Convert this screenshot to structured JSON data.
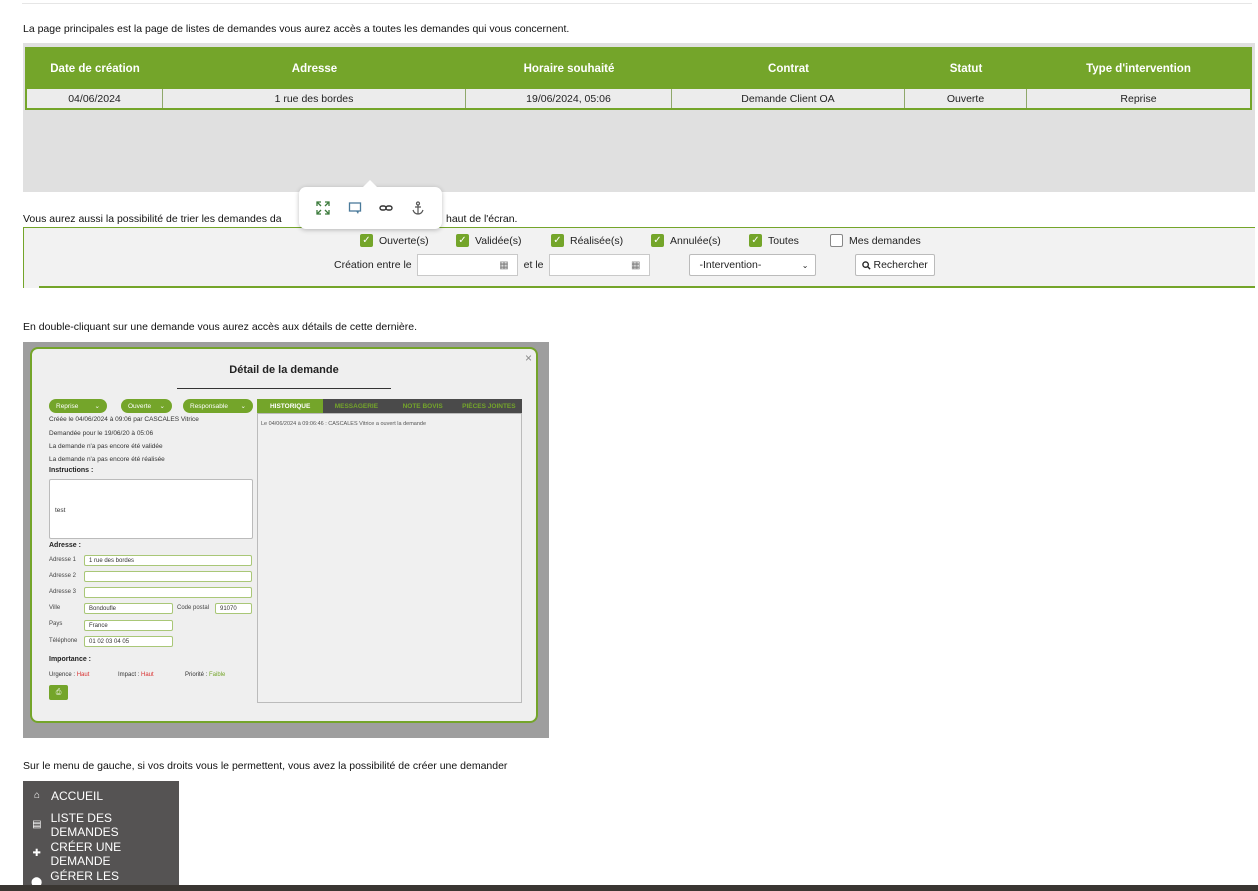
{
  "intro_text": "La page principales est la page de listes de demandes vous aurez accès a toutes les demandes qui vous concernent.",
  "table": {
    "headers": [
      "Date de création",
      "Adresse",
      "Horaire souhaité",
      "Contrat",
      "Statut",
      "Type d'intervention"
    ],
    "rows": [
      [
        "04/06/2024",
        "1 rue des bordes",
        "19/06/2024, 05:06",
        "Demande Client OA",
        "Ouverte",
        "Reprise"
      ]
    ]
  },
  "popover_icons": [
    "expand-icon",
    "comment-icon",
    "link-icon",
    "anchor-icon"
  ],
  "filter_text_left": "Vous aurez aussi la possibilité de trier les demandes da",
  "filter_text_right": "haut de l'écran.",
  "filters": {
    "checkboxes": [
      {
        "label": "Ouverte(s)",
        "checked": true
      },
      {
        "label": "Validée(s)",
        "checked": true
      },
      {
        "label": "Réalisée(s)",
        "checked": true
      },
      {
        "label": "Annulée(s)",
        "checked": true
      },
      {
        "label": "Toutes",
        "checked": true
      },
      {
        "label": "Mes demandes",
        "checked": false
      }
    ],
    "creation_label": "Création entre le",
    "and_label": "et le",
    "intervention_select": "-Intervention-",
    "search_button": "Rechercher"
  },
  "detail_text": "En double-cliquant sur une demande vous aurez accès aux détails de cette dernière.",
  "modal": {
    "title": "Détail de la demande",
    "pills": [
      "Reprise",
      "Ouverte",
      "Responsable"
    ],
    "tabs": [
      "HISTORIQUE",
      "MESSAGERIE",
      "NOTE BOVIS",
      "PIÈCES JOINTES"
    ],
    "history_line": "Le 04/06/2024 à 09:06:46 : CASCALES Vitrice a ouvert la demande",
    "info_lines": [
      "Créée le 04/06/2024 à 09:06 par CASCALES Vitrice",
      "Demandée pour le 19/06/20 à 05:06",
      "La demande n'a pas encore été validée",
      "La demande n'a pas encore été réalisée"
    ],
    "instructions_label": "Instructions :",
    "instructions_value": "test",
    "address_label": "Adresse :",
    "fields": {
      "adresse1_label": "Adresse 1",
      "adresse1": "1 rue des bordes",
      "adresse2_label": "Adresse 2",
      "adresse2": "",
      "adresse3_label": "Adresse 3",
      "adresse3": "",
      "ville_label": "Ville",
      "ville": "Bondoufle",
      "cp_label": "Code postal",
      "cp": "91070",
      "pays_label": "Pays",
      "pays": "France",
      "tel_label": "Téléphone",
      "tel": "01 02 03 04 05"
    },
    "importance_label": "Importance :",
    "urgence_label": "Urgence :",
    "urgence": "Haut",
    "impact_label": "Impact :",
    "impact": "Haut",
    "priorite_label": "Priorité :",
    "priorite": "Faible"
  },
  "menu_text": "Sur le menu de gauche, si vos droits vous le permettent, vous avez la possibilité de créer une demander",
  "menu": [
    {
      "label": "ACCUEIL",
      "icon": "home-icon"
    },
    {
      "label": "LISTE DES DEMANDES",
      "icon": "list-icon"
    },
    {
      "label": "CRÉER UNE DEMANDE",
      "icon": "plus-icon"
    },
    {
      "label": "GÉRER LES ADRESSES",
      "icon": "location-icon"
    }
  ],
  "colors": {
    "accent": "#74a52a",
    "menu_bg": "#555353",
    "gray_bg": "#e0e0e0"
  }
}
